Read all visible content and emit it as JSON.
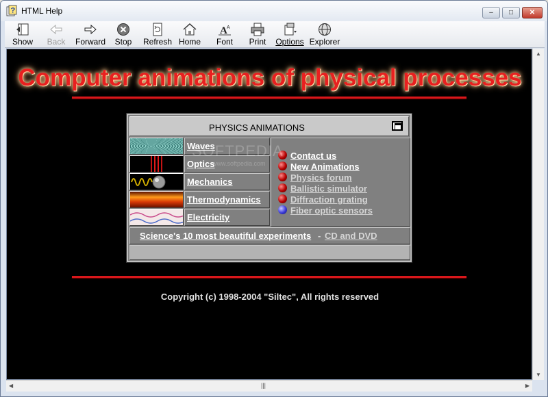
{
  "window": {
    "title": "HTML Help",
    "minimize_glyph": "–",
    "maximize_glyph": "□",
    "close_glyph": "✕"
  },
  "toolbar": {
    "items": [
      {
        "label": "Show",
        "icon": "show-icon"
      },
      {
        "label": "Back",
        "icon": "back-arrow-icon",
        "disabled": true
      },
      {
        "label": "Forward",
        "icon": "forward-arrow-icon"
      },
      {
        "label": "Stop",
        "icon": "stop-icon"
      },
      {
        "label": "Refresh",
        "icon": "refresh-icon"
      },
      {
        "label": "Home",
        "icon": "home-icon"
      },
      {
        "label": "Font",
        "icon": "font-icon"
      },
      {
        "label": "Print",
        "icon": "printer-icon"
      },
      {
        "label": "Options",
        "icon": "options-icon"
      },
      {
        "label": "Explorer",
        "icon": "explorer-icon"
      }
    ]
  },
  "page": {
    "headline": "Computer animations of physical processes",
    "watermark": "SOFTPEDIA",
    "watermark_url": "www.softpedia.com",
    "panel": {
      "title": "PHYSICS ANIMATIONS",
      "categories": [
        {
          "label": "Waves",
          "thumb": "waves-thumbnail"
        },
        {
          "label": "Optics",
          "thumb": "optics-thumbnail"
        },
        {
          "label": "Mechanics",
          "thumb": "mechanics-thumbnail"
        },
        {
          "label": "Thermodynamics",
          "thumb": "thermodynamics-thumbnail"
        },
        {
          "label": "Electricity",
          "thumb": "electricity-thumbnail"
        }
      ],
      "links": [
        {
          "label": "Contact us",
          "bullet": "red-sphere-icon"
        },
        {
          "label": "New Animations",
          "bullet": "red-sphere-icon"
        },
        {
          "label": "Physics forum",
          "bullet": "red-sphere-icon"
        },
        {
          "label": "Ballistic simulator",
          "bullet": "red-sphere-icon"
        },
        {
          "label": "Diffraction grating",
          "bullet": "red-sphere-icon"
        },
        {
          "label": "Fiber optic sensors",
          "bullet": "blue-sphere-icon"
        }
      ],
      "bottom": {
        "science_link": "Science's 10 most beautiful experiments",
        "separator": "-",
        "cd_link": "CD and DVD"
      }
    },
    "copyright": "Copyright (c) 1998-2004 \"Siltec\", All rights reserved"
  },
  "colors": {
    "headline": "#e82020",
    "divider": "#d8171b",
    "panel_bg": "#808080",
    "content_bg": "#000000"
  }
}
